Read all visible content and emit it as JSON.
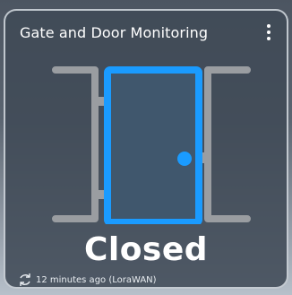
{
  "card": {
    "title": "Gate and Door Monitoring",
    "status": "Closed",
    "updated": "12 minutes ago (LoraWAN)",
    "icons": {
      "menu": "more-vertical-icon",
      "refresh": "refresh-icon",
      "door": "door-closed-icon"
    },
    "colors": {
      "door": "#1a9bff",
      "frame": "#9a9da1",
      "card": "#404a56",
      "text": "#ffffff"
    }
  }
}
